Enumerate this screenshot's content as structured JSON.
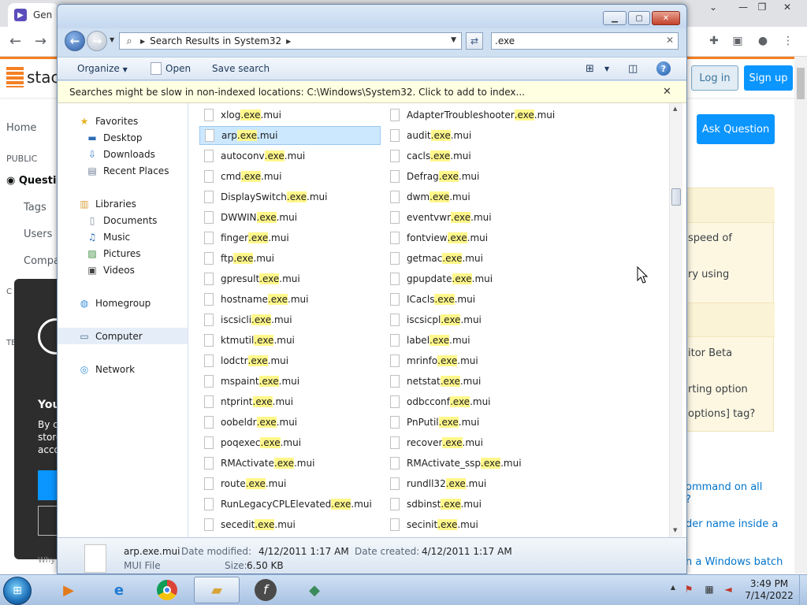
{
  "background": {
    "tab_title": "Gen",
    "login": "Log in",
    "signup": "Sign up",
    "ask_question": "Ask Question",
    "left_nav": [
      "Home",
      "PUBLIC",
      "Questio",
      "Tags",
      "Users",
      "Compa",
      "C",
      "TE"
    ],
    "cookie": {
      "heading": "You",
      "lines": [
        "By c",
        "store",
        "acco"
      ],
      "footer": "Why"
    },
    "sidebar_snippets": [
      "speed of",
      "ry using",
      "itor Beta",
      "rting option",
      "options] tag?"
    ],
    "related_links": [
      "ommand on all",
      "?",
      "der name inside a",
      "n a Windows batch"
    ],
    "logo_text": "stack"
  },
  "explorer": {
    "address": "Search Results in System32",
    "search_value": ".exe",
    "toolbar": {
      "organize": "Organize",
      "open": "Open",
      "save_search": "Save search"
    },
    "infobar": "Searches might be slow in non-indexed locations: C:\\Windows\\System32. Click to add to index...",
    "nav": {
      "favorites": "Favorites",
      "desktop": "Desktop",
      "downloads": "Downloads",
      "recent_places": "Recent Places",
      "libraries": "Libraries",
      "documents": "Documents",
      "music": "Music",
      "pictures": "Pictures",
      "videos": "Videos",
      "homegroup": "Homegroup",
      "computer": "Computer",
      "network": "Network"
    },
    "files_col1": [
      [
        "xlog",
        ".mui"
      ],
      [
        "arp",
        ".mui"
      ],
      [
        "autoconv",
        ".mui"
      ],
      [
        "cmd",
        ".mui"
      ],
      [
        "DisplaySwitch",
        ".mui"
      ],
      [
        "DWWIN",
        ".mui"
      ],
      [
        "finger",
        ".mui"
      ],
      [
        "ftp",
        ".mui"
      ],
      [
        "gpresult",
        ".mui"
      ],
      [
        "hostname",
        ".mui"
      ],
      [
        "iscsicli",
        ".mui"
      ],
      [
        "ktmutil",
        ".mui"
      ],
      [
        "lodctr",
        ".mui"
      ],
      [
        "mspaint",
        ".mui"
      ],
      [
        "ntprint",
        ".mui"
      ],
      [
        "oobeldr",
        ".mui"
      ],
      [
        "poqexec",
        ".mui"
      ],
      [
        "RMActivate",
        ".mui"
      ],
      [
        "route",
        ".mui"
      ],
      [
        "RunLegacyCPLElevated",
        ".mui"
      ],
      [
        "secedit",
        ".mui"
      ]
    ],
    "files_col2": [
      [
        "AdapterTroubleshooter",
        ".mui"
      ],
      [
        "audit",
        ".mui"
      ],
      [
        "cacls",
        ".mui"
      ],
      [
        "Defrag",
        ".mui"
      ],
      [
        "dwm",
        ".mui"
      ],
      [
        "eventvwr",
        ".mui"
      ],
      [
        "fontview",
        ".mui"
      ],
      [
        "getmac",
        ".mui"
      ],
      [
        "gpupdate",
        ".mui"
      ],
      [
        "ICacls",
        ".mui"
      ],
      [
        "iscsicpl",
        ".mui"
      ],
      [
        "label",
        ".mui"
      ],
      [
        "mrinfo",
        ".mui"
      ],
      [
        "netstat",
        ".mui"
      ],
      [
        "odbcconf",
        ".mui"
      ],
      [
        "PnPutil",
        ".mui"
      ],
      [
        "recover",
        ".mui"
      ],
      [
        "RMActivate_ssp",
        ".mui"
      ],
      [
        "rundll32",
        ".mui"
      ],
      [
        "sdbinst",
        ".mui"
      ],
      [
        "secinit",
        ".mui"
      ]
    ],
    "highlight": ".exe",
    "selected_index": 1,
    "details": {
      "name": "arp.exe.mui",
      "type": "MUI File",
      "modified_label": "Date modified:",
      "modified_value": "4/12/2011 1:17 AM",
      "created_label": "Date created:",
      "created_value": "4/12/2011 1:17 AM",
      "size_label": "Size:",
      "size_value": "6.50 KB"
    }
  },
  "taskbar": {
    "time": "3:49 PM",
    "date": "7/14/2022"
  }
}
